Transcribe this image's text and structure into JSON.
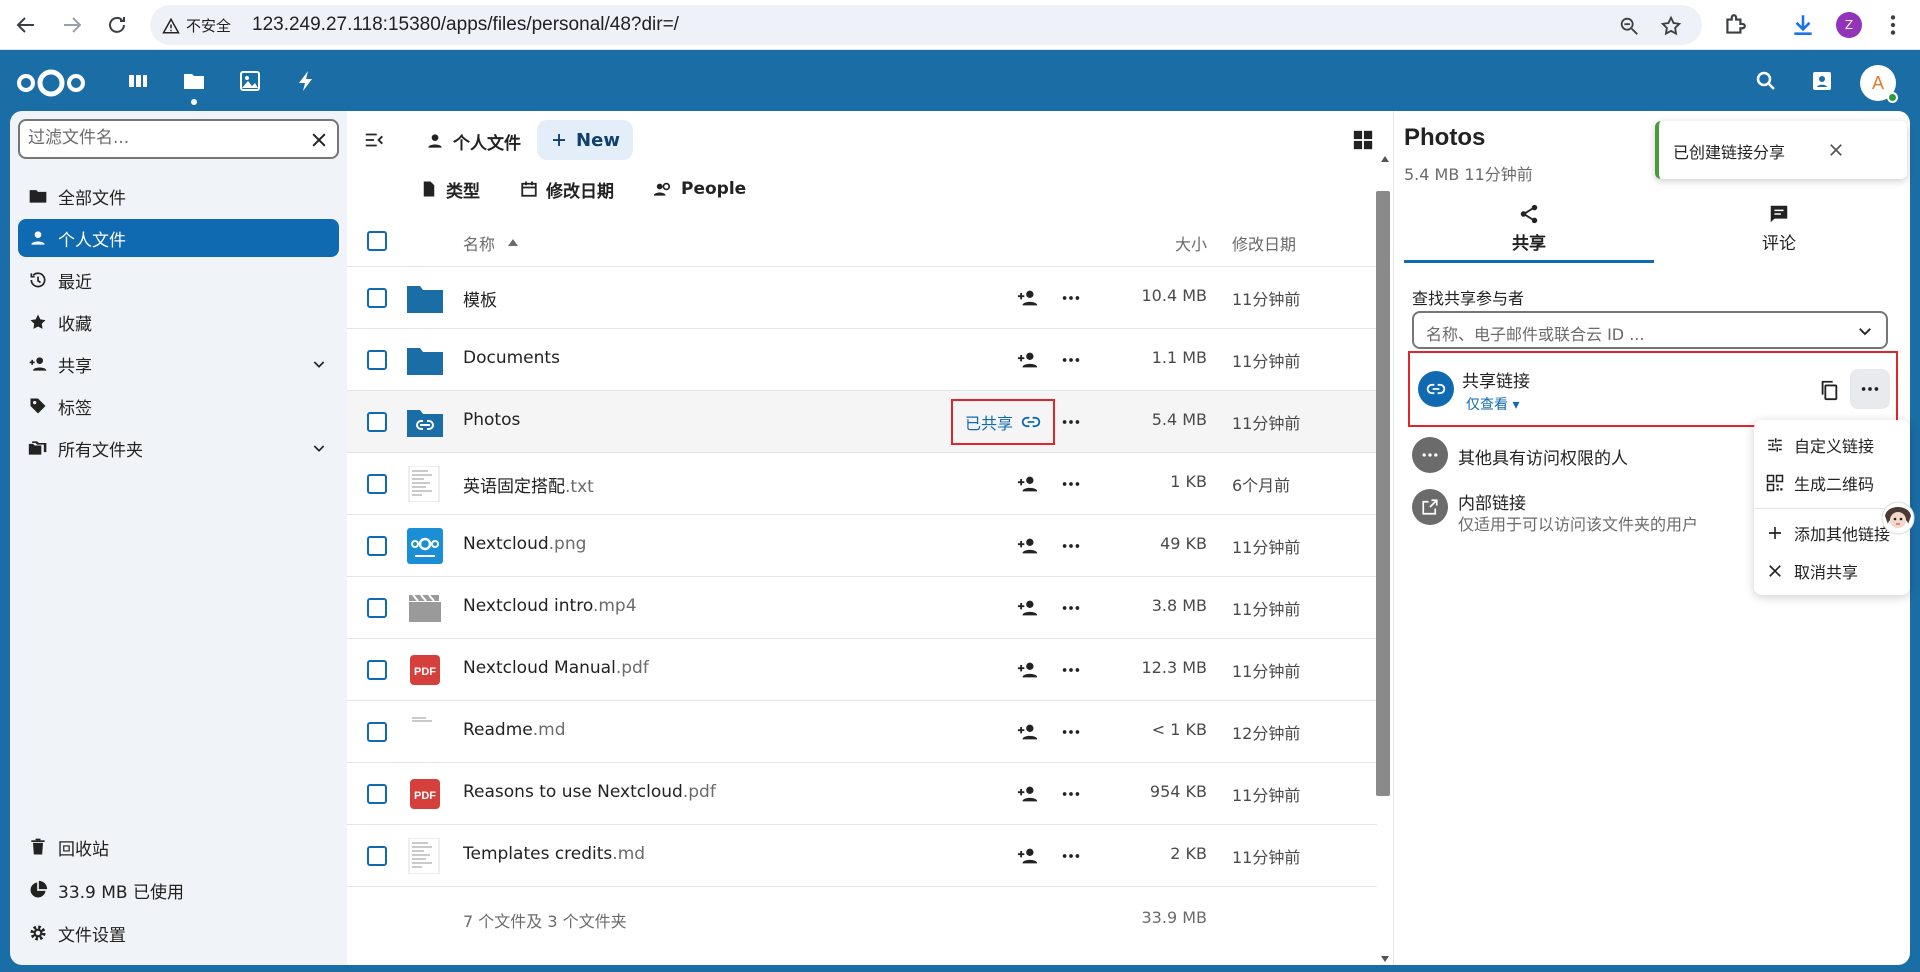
{
  "browser": {
    "security_label": "不安全",
    "url": "123.249.27.118:15380/apps/files/personal/48?dir=/",
    "profile_initial": "Z"
  },
  "header": {
    "avatar_initial": "A"
  },
  "sidebar": {
    "filter_placeholder": "过滤文件名...",
    "items": [
      {
        "label": "全部文件"
      },
      {
        "label": "个人文件"
      },
      {
        "label": "最近"
      },
      {
        "label": "收藏"
      },
      {
        "label": "共享"
      },
      {
        "label": "标签"
      },
      {
        "label": "所有文件夹"
      }
    ],
    "bottom": [
      {
        "label": "回收站"
      },
      {
        "label": "33.9 MB 已使用"
      },
      {
        "label": "文件设置"
      }
    ]
  },
  "main": {
    "breadcrumb": "个人文件",
    "new_label": "New",
    "filters": [
      "类型",
      "修改日期",
      "People"
    ],
    "columns": {
      "name": "名称",
      "size": "大小",
      "modified": "修改日期"
    },
    "files": [
      {
        "name": "模板",
        "ext": "",
        "size": "10.4 MB",
        "modified": "11分钟前",
        "type": "folder"
      },
      {
        "name": "Documents",
        "ext": "",
        "size": "1.1 MB",
        "modified": "11分钟前",
        "type": "folder"
      },
      {
        "name": "Photos",
        "ext": "",
        "size": "5.4 MB",
        "modified": "11分钟前",
        "type": "folder-link"
      },
      {
        "name": "英语固定搭配",
        "ext": ".txt",
        "size": "1 KB",
        "modified": "6个月前",
        "type": "text"
      },
      {
        "name": "Nextcloud",
        "ext": ".png",
        "size": "49 KB",
        "modified": "11分钟前",
        "type": "image"
      },
      {
        "name": "Nextcloud intro",
        "ext": ".mp4",
        "size": "3.8 MB",
        "modified": "11分钟前",
        "type": "video"
      },
      {
        "name": "Nextcloud Manual",
        "ext": ".pdf",
        "size": "12.3 MB",
        "modified": "11分钟前",
        "type": "pdf"
      },
      {
        "name": "Readme",
        "ext": ".md",
        "size": "< 1 KB",
        "modified": "12分钟前",
        "type": "text"
      },
      {
        "name": "Reasons to use Nextcloud",
        "ext": ".pdf",
        "size": "954 KB",
        "modified": "11分钟前",
        "type": "pdf"
      },
      {
        "name": "Templates credits",
        "ext": ".md",
        "size": "2 KB",
        "modified": "11分钟前",
        "type": "text"
      }
    ],
    "shared_label": "已共享",
    "summary": "7 个文件及 3 个文件夹",
    "total_size": "33.9 MB"
  },
  "details": {
    "title": "Photos",
    "subtitle": "5.4 MB 11分钟前",
    "tabs": [
      {
        "label": "共享"
      },
      {
        "label": "评论"
      }
    ],
    "search_label": "查找共享参与者",
    "search_placeholder": "名称、电子邮件或联合云 ID ...",
    "link_share": {
      "name": "共享链接",
      "permission": "仅查看"
    },
    "others_label": "其他具有访问权限的人",
    "internal": {
      "title": "内部链接",
      "subtitle": "仅适用于可以访问该文件夹的用户"
    }
  },
  "toast": {
    "message": "已创建链接分享"
  },
  "menu": {
    "items": [
      {
        "label": "自定义链接"
      },
      {
        "label": "生成二维码"
      },
      {
        "label": "添加其他链接"
      },
      {
        "label": "取消共享"
      }
    ]
  },
  "colors": {
    "brand": "#0f6ab1",
    "header_bg": "#1b6da5",
    "highlight_border": "#e0262c",
    "pdf_red": "#d6403c"
  }
}
